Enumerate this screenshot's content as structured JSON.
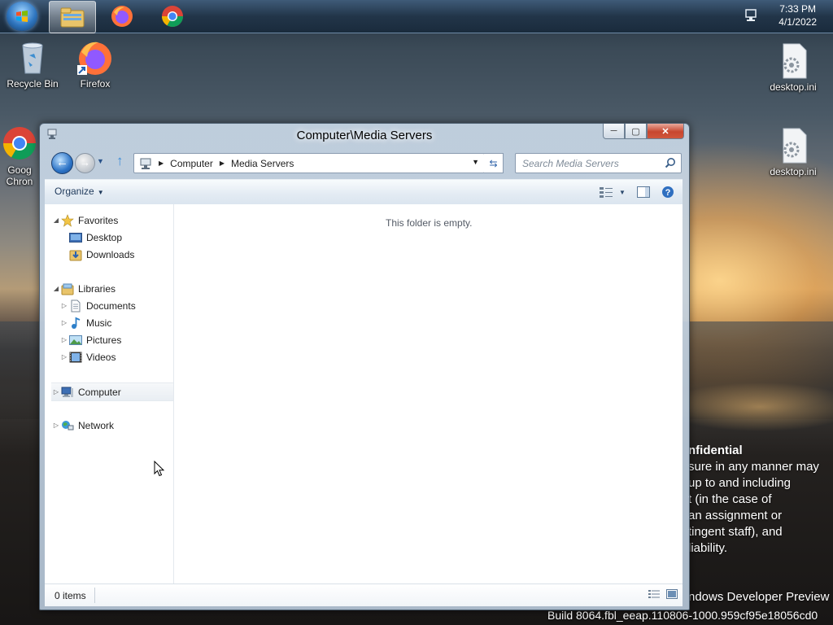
{
  "taskbar": {
    "apps": [
      {
        "name": "Windows Explorer",
        "icon": "folder-icon",
        "active": true
      },
      {
        "name": "Firefox",
        "icon": "firefox-icon",
        "active": false
      },
      {
        "name": "Google Chrome",
        "icon": "chrome-icon",
        "active": false
      }
    ],
    "clock_time": "7:33 PM",
    "clock_date": "4/1/2022"
  },
  "desktop": {
    "icons": [
      {
        "label": "Recycle Bin",
        "icon": "recycle-bin-icon"
      },
      {
        "label": "Firefox",
        "icon": "firefox-icon"
      },
      {
        "label": "Goog\nChron",
        "icon": "chrome-icon"
      },
      {
        "label": "desktop.ini",
        "icon": "settings-file-icon"
      },
      {
        "label": "desktop.ini",
        "icon": "settings-file-icon"
      }
    ],
    "watermark": {
      "line1": "nfidential",
      "line2": "sure in any manner may",
      "line3": "up to and including",
      "line4": "t (in the case of",
      "line5": "an assignment or",
      "line6": "tingent staff), and",
      "line7": "liability.",
      "line8": "ndows Developer Preview",
      "line9": "Build 8064.fbl_eeap.110806-1000.959cf95e18056cd0"
    }
  },
  "window": {
    "title": "Computer\\Media Servers",
    "address": {
      "segments": [
        "Computer",
        "Media Servers"
      ]
    },
    "search": {
      "placeholder": "Search Media Servers"
    },
    "toolbar": {
      "organize_label": "Organize"
    },
    "nav": {
      "favorites": "Favorites",
      "desktop": "Desktop",
      "downloads": "Downloads",
      "libraries": "Libraries",
      "documents": "Documents",
      "music": "Music",
      "pictures": "Pictures",
      "videos": "Videos",
      "computer": "Computer",
      "network": "Network"
    },
    "empty_message": "This folder is empty.",
    "status": {
      "item_count": "0 items"
    }
  },
  "colors": {
    "accent": "#2c73c6",
    "close_button": "#c7462f"
  }
}
